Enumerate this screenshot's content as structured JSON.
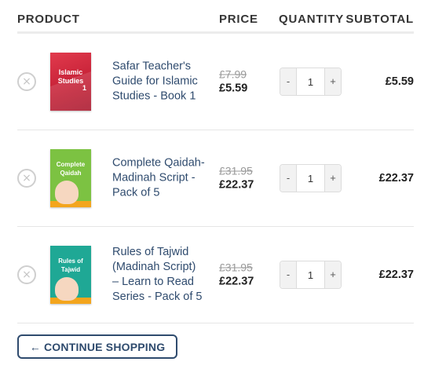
{
  "header": {
    "product": "PRODUCT",
    "price": "PRICE",
    "quantity": "QUANTITY",
    "subtotal": "SUBTOTAL"
  },
  "remove_symbol": "×",
  "items": [
    {
      "name": "Safar Teacher's Guide for Islamic Studies - Book 1",
      "old_price": "£7.99",
      "new_price": "£5.59",
      "quantity": "1",
      "subtotal": "£5.59",
      "thumb_title": "Islamic Studies",
      "thumb_number": "1",
      "thumb_color": "#d8293e"
    },
    {
      "name": "Complete Qaidah- Madinah Script - Pack of 5",
      "old_price": "£31.95",
      "new_price": "£22.37",
      "quantity": "1",
      "subtotal": "£22.37",
      "thumb_title": "Complete Qaidah",
      "thumb_color": "#7cc242"
    },
    {
      "name": "Rules of Tajwid (Madinah Script) – Learn to Read Series - Pack of 5",
      "old_price": "£31.95",
      "new_price": "£22.37",
      "quantity": "1",
      "subtotal": "£22.37",
      "thumb_title": "Rules of Tajwid",
      "thumb_color": "#1fa895"
    }
  ],
  "qty_minus": "-",
  "qty_plus": "+",
  "continue_button": "← CONTINUE SHOPPING",
  "colors": {
    "link": "#2f4b6e",
    "button_border": "#2f4b6e"
  }
}
